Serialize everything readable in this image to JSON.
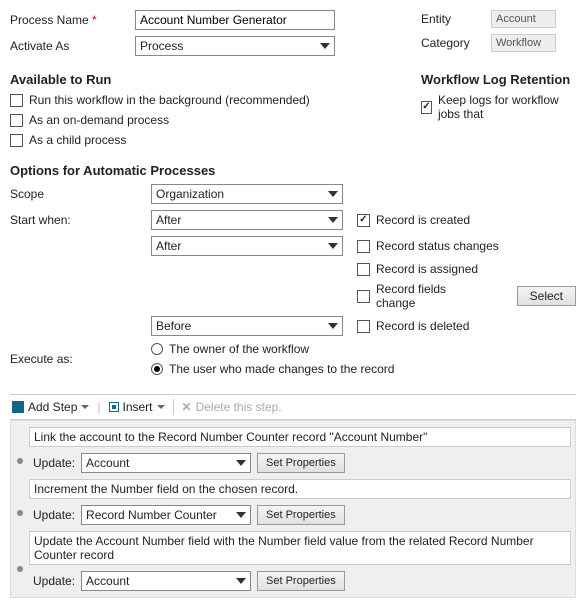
{
  "header": {
    "processNameLabel": "Process Name",
    "processNameValue": "Account Number Generator",
    "activateAsLabel": "Activate As",
    "activateAsValue": "Process",
    "entityLabel": "Entity",
    "entityValue": "Account",
    "categoryLabel": "Category",
    "categoryValue": "Workflow"
  },
  "available": {
    "heading": "Available to Run",
    "opt1": "Run this workflow in the background (recommended)",
    "opt2": "As an on-demand process",
    "opt3": "As a child process"
  },
  "logRetention": {
    "heading": "Workflow Log Retention",
    "opt1": "Keep logs for workflow jobs that"
  },
  "autoOpts": {
    "heading": "Options for Automatic Processes",
    "scopeLabel": "Scope",
    "scopeValue": "Organization",
    "startWhenLabel": "Start when:",
    "after1": "After",
    "after2": "After",
    "before": "Before",
    "created": "Record is created",
    "statusChanges": "Record status changes",
    "assigned": "Record is assigned",
    "fieldsChange": "Record fields change",
    "selectBtn": "Select",
    "deleted": "Record is deleted",
    "executeAsLabel": "Execute as:",
    "execOwner": "The owner of the workflow",
    "execUser": "The user who made changes to the record"
  },
  "toolbar": {
    "addStep": "Add Step",
    "insert": "Insert",
    "delete": "Delete this step."
  },
  "steps": [
    {
      "desc": "Link the account to the Record Number Counter record \"Account Number\"",
      "actionLabel": "Update:",
      "target": "Account",
      "btn": "Set Properties"
    },
    {
      "desc": "Increment the Number field on the chosen record.",
      "actionLabel": "Update:",
      "target": "Record Number Counter",
      "btn": "Set Properties"
    },
    {
      "desc": "Update the Account Number field with the Number field value from the related Record Number Counter record",
      "actionLabel": "Update:",
      "target": "Account",
      "btn": "Set Properties"
    }
  ]
}
